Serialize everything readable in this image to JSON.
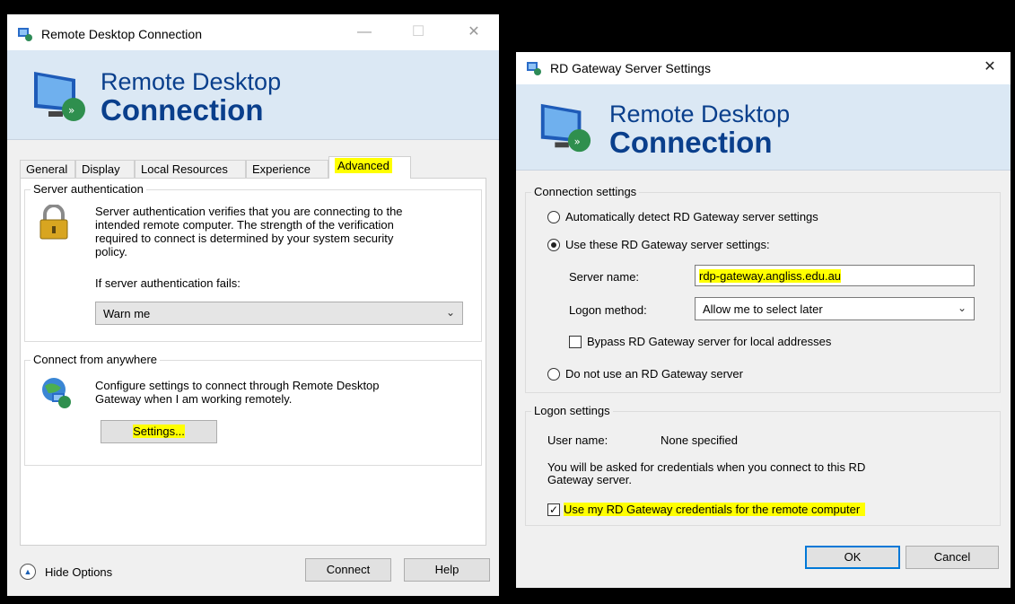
{
  "rdc": {
    "title": "Remote Desktop Connection",
    "banner_line1": "Remote Desktop",
    "banner_line2": "Connection",
    "tabs": [
      "General",
      "Display",
      "Local Resources",
      "Experience",
      "Advanced"
    ],
    "active_tab": "Advanced",
    "server_auth": {
      "label": "Server authentication",
      "desc_lines": [
        "Server authentication verifies that you are connecting to the",
        "intended remote computer. The strength of the verification",
        "required to connect is determined by your system security",
        "policy."
      ],
      "fails_label": "If server authentication fails:",
      "fails_value": "Warn me"
    },
    "anywhere": {
      "label": "Connect from anywhere",
      "desc_lines": [
        "Configure settings to connect through Remote Desktop",
        "Gateway when I am working remotely."
      ],
      "settings_button": "Settings..."
    },
    "hide_options": "Hide Options",
    "connect_button": "Connect",
    "help_button": "Help"
  },
  "gateway": {
    "title": "RD Gateway Server Settings",
    "banner_line1": "Remote Desktop",
    "banner_line2": "Connection",
    "conn": {
      "label": "Connection settings",
      "auto_detect": "Automatically detect RD Gateway server settings",
      "use_these": "Use these RD Gateway server settings:",
      "server_name_label": "Server name:",
      "server_name_value": "rdp-gateway.angliss.edu.au",
      "logon_method_label": "Logon method:",
      "logon_method_value": "Allow me to select later",
      "bypass": "Bypass RD Gateway server for local addresses",
      "do_not_use": "Do not use an RD Gateway server",
      "selected": "use_these"
    },
    "logon": {
      "label": "Logon settings",
      "user_name_label": "User name:",
      "user_name_value": "None specified",
      "note_lines": [
        "You will be asked for credentials when you connect to this RD",
        "Gateway server."
      ],
      "use_creds": "Use my RD Gateway credentials for the remote computer",
      "use_creds_checked": true
    },
    "ok_button": "OK",
    "cancel_button": "Cancel"
  },
  "colors": {
    "highlight": "#ffff00",
    "banner": "#dbe8f4",
    "banner_text": "#0a3f8c",
    "accent": "#0078d7"
  }
}
